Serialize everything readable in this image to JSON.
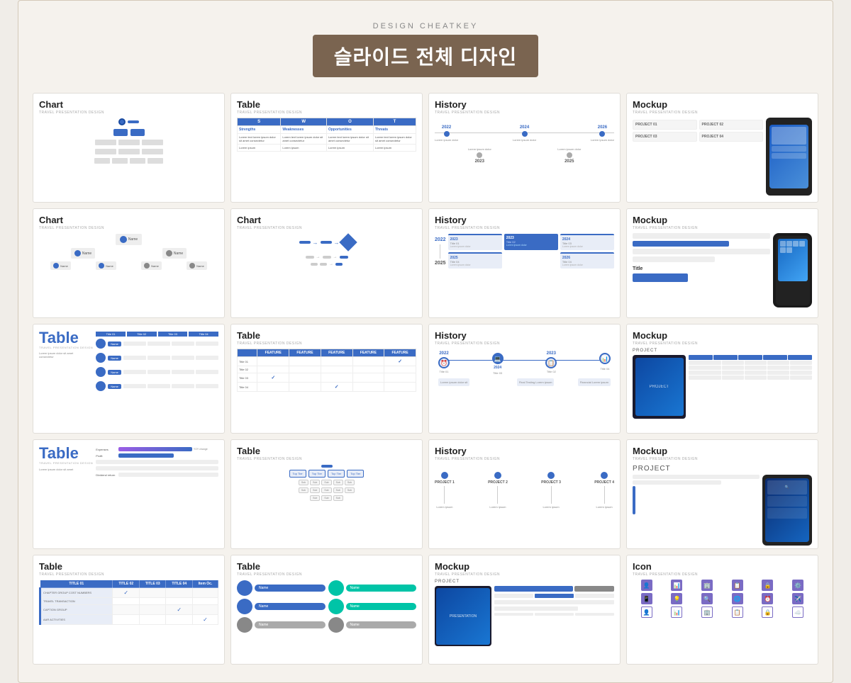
{
  "header": {
    "brand": "DESIGN CHEATKEY",
    "title": "슬라이드 전체 디자인"
  },
  "subtitle": "TRAVEL PRESENTATION DESIGN",
  "colors": {
    "blue": "#3a6bc4",
    "gray": "#888888",
    "lightblue": "#e8edf7"
  },
  "slides": [
    {
      "id": 1,
      "title": "Chart",
      "type": "chart-org"
    },
    {
      "id": 2,
      "title": "Table",
      "type": "table-swot"
    },
    {
      "id": 3,
      "title": "History",
      "type": "history-timeline"
    },
    {
      "id": 4,
      "title": "Mockup",
      "type": "mockup-projects"
    },
    {
      "id": 5,
      "title": "Chart",
      "type": "chart-org2"
    },
    {
      "id": 6,
      "title": "Chart",
      "type": "chart-flow"
    },
    {
      "id": 7,
      "title": "History",
      "type": "history-blocks"
    },
    {
      "id": 8,
      "title": "Mockup",
      "type": "mockup-phone"
    },
    {
      "id": 9,
      "title": "Table",
      "type": "table-person"
    },
    {
      "id": 10,
      "title": "Table",
      "type": "table-feature"
    },
    {
      "id": 11,
      "title": "History",
      "type": "history-icons"
    },
    {
      "id": 12,
      "title": "Mockup",
      "type": "mockup-project-table"
    },
    {
      "id": 13,
      "title": "Table",
      "type": "table-large-title"
    },
    {
      "id": 14,
      "title": "Table",
      "type": "table-org-tree"
    },
    {
      "id": 15,
      "title": "History",
      "type": "history-projects"
    },
    {
      "id": 16,
      "title": "Mockup",
      "type": "mockup-tablet"
    },
    {
      "id": 17,
      "title": "Table",
      "type": "table-checkmarks"
    },
    {
      "id": 18,
      "title": "Table",
      "type": "table-colored-people"
    },
    {
      "id": 19,
      "title": "Mockup",
      "type": "mockup-presentation"
    },
    {
      "id": 20,
      "title": "Icon",
      "type": "icon-grid"
    }
  ]
}
